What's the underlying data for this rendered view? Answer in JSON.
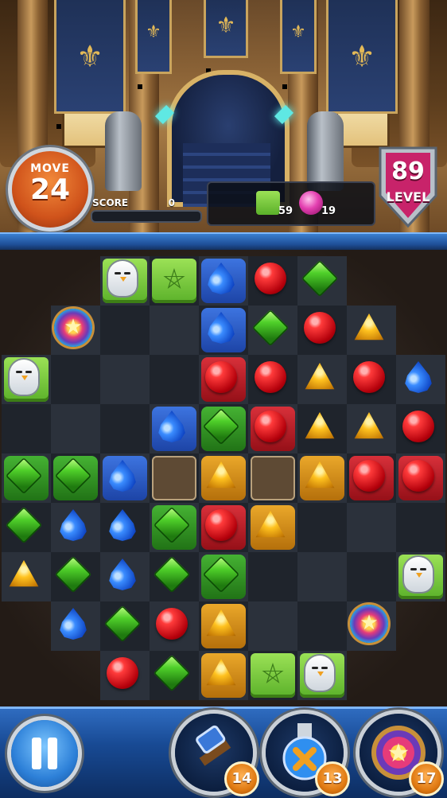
{
  "hud": {
    "move_label": "MOVE",
    "move_value": "24",
    "score_label": "SCORE",
    "score_value": "0",
    "score_progress": 0.0,
    "level_number": "89",
    "level_label": "LEVEL"
  },
  "goals": [
    {
      "icon": "green-pentagram-block-icon",
      "count": "59",
      "color": "#6cc63a"
    },
    {
      "icon": "pink-gem-icon",
      "count": "19",
      "color": "#e33fb0"
    }
  ],
  "board": {
    "rows": [
      [
        "void",
        "void",
        "owl",
        "pent",
        "blue",
        "red",
        "green",
        "void",
        "void"
      ],
      [
        "void",
        "medal",
        "dark",
        "dark",
        "blue",
        "green",
        "red",
        "gold",
        "void"
      ],
      [
        "owl",
        "dark",
        "dark",
        "dark",
        "red",
        "red",
        "gold",
        "red",
        "blue"
      ],
      [
        "dark",
        "dark",
        "dark",
        "blue",
        "green",
        "red",
        "gold",
        "gold",
        "red"
      ],
      [
        "green",
        "green",
        "blue",
        "empty",
        "gold",
        "empty",
        "gold",
        "red",
        "red"
      ],
      [
        "green",
        "blue",
        "blue",
        "green",
        "red",
        "gold",
        "dark",
        "dark",
        "dark"
      ],
      [
        "gold",
        "green",
        "blue",
        "green",
        "green",
        "dark",
        "dark",
        "dark",
        "owl"
      ],
      [
        "void",
        "blue",
        "green",
        "red",
        "gold",
        "dark",
        "dark",
        "medal",
        "void"
      ],
      [
        "void",
        "void",
        "red",
        "green",
        "gold",
        "pent",
        "owl",
        "void",
        "void"
      ]
    ],
    "tiled": [
      "",
      "",
      "",
      "",
      "b",
      "",
      "",
      "",
      "",
      "",
      "",
      "",
      "",
      "b",
      "",
      "",
      "",
      "",
      "",
      "",
      "",
      "",
      "r",
      "",
      "",
      "",
      "",
      "",
      "",
      "",
      "b",
      "g",
      "r",
      "",
      "",
      "",
      "g",
      "g",
      "b",
      "",
      "y",
      "",
      "y",
      "r",
      "r",
      "",
      "",
      "",
      "g",
      "r",
      "y",
      "",
      "",
      "",
      "",
      "",
      "",
      "",
      "g",
      "",
      "",
      "",
      "",
      "",
      "",
      "",
      "",
      "y",
      "",
      "",
      "",
      "",
      "",
      "",
      "",
      "",
      "y",
      "",
      "",
      "",
      ""
    ]
  },
  "boosters": [
    {
      "name": "hammer-booster",
      "icon": "hammer-icon",
      "count": "14"
    },
    {
      "name": "potion-booster",
      "icon": "potion-bottle-icon",
      "count": "13"
    },
    {
      "name": "magic-medal-booster",
      "icon": "rainbow-medal-icon",
      "count": "17"
    }
  ]
}
